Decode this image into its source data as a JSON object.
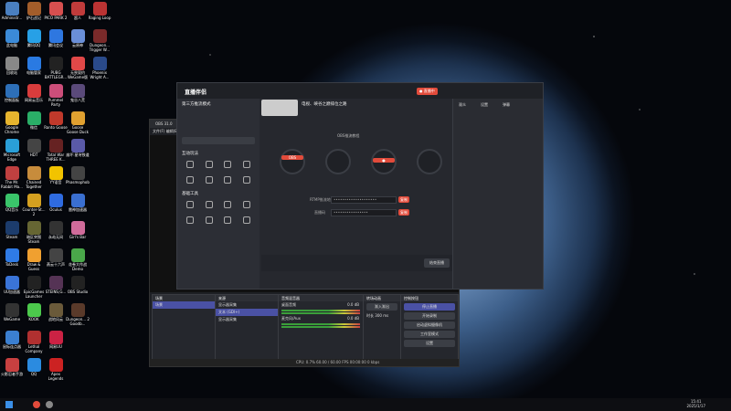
{
  "desktop": {
    "icons": [
      {
        "label": "Administr...",
        "color": "#4a7fc0"
      },
      {
        "label": "此电脑",
        "color": "#3b8ad8"
      },
      {
        "label": "回收站",
        "color": "#888"
      },
      {
        "label": "控制面板",
        "color": "#2d6fb8"
      },
      {
        "label": "Google Chrome",
        "color": "#e6b42e"
      },
      {
        "label": "Microsoft Edge",
        "color": "#2a9fd8"
      },
      {
        "label": "The Mr. Rabbit Ma...",
        "color": "#c04040"
      },
      {
        "label": "QQ音乐",
        "color": "#3ac46a"
      },
      {
        "label": "Steam",
        "color": "#1c3c6c"
      },
      {
        "label": "ToDesk",
        "color": "#2f7be6"
      },
      {
        "label": "UU加速器",
        "color": "#3a74d8"
      },
      {
        "label": "WeGame",
        "color": "#333"
      },
      {
        "label": "鼠标连点器",
        "color": "#3b7fd0"
      },
      {
        "label": "火影忍者手游",
        "color": "#c84040"
      }
    ],
    "icons2": [
      {
        "label": "炉石战记",
        "color": "#a35d2a"
      },
      {
        "label": "腾讯QQ",
        "color": "#27a0e6"
      },
      {
        "label": "电脑管家",
        "color": "#2a7ae2"
      },
      {
        "label": "网易云音乐",
        "color": "#d83c3c"
      },
      {
        "label": "微信",
        "color": "#2aae67"
      },
      {
        "label": "HDT",
        "color": "#444"
      },
      {
        "label": "Chained Together",
        "color": "#c78c3c"
      },
      {
        "label": "Counter-St... 2",
        "color": "#d4a020"
      },
      {
        "label": "暗区突围Steam",
        "color": "#663"
      },
      {
        "label": "Draw & Guess",
        "color": "#f0a030"
      },
      {
        "label": "EpicGames Launcher",
        "color": "#222"
      },
      {
        "label": "KOOK",
        "color": "#4cc94c"
      },
      {
        "label": "Lethal Company",
        "color": "#b03030"
      },
      {
        "label": "QQ",
        "color": "#2b8be0"
      }
    ],
    "icons3": [
      {
        "label": "PICO PARK 2",
        "color": "#d64f4f"
      },
      {
        "label": "腾讯会议",
        "color": "#2e77e0"
      },
      {
        "label": "PUBG BATTLEGR...",
        "color": "#222"
      },
      {
        "label": "Pummel Party",
        "color": "#cc4e7a"
      },
      {
        "label": "Ranto Goose",
        "color": "#c0392b"
      },
      {
        "label": "Total War THREE K...",
        "color": "#662222"
      },
      {
        "label": "YY语音",
        "color": "#f2c300"
      },
      {
        "label": "Oculus",
        "color": "#2f6be0"
      },
      {
        "label": "永劫无间",
        "color": "#333"
      },
      {
        "label": "燕云十六声",
        "color": "#444"
      },
      {
        "label": "STEINS;G...",
        "color": "#553355"
      },
      {
        "label": "战地风云",
        "color": "#6a5a3a"
      },
      {
        "label": "网易UU",
        "color": "#c24"
      },
      {
        "label": "Apex Legends",
        "color": "#c22"
      }
    ],
    "icons4": [
      {
        "label": "超人",
        "color": "#c03b3b"
      },
      {
        "label": "云原神",
        "color": "#6a8fd8"
      },
      {
        "label": "无畏契约 WeGame版",
        "color": "#e14848"
      },
      {
        "label": "鬼谷八荒",
        "color": "#5a4a7a"
      },
      {
        "label": "Goose Goose Duck",
        "color": "#e0a030"
      },
      {
        "label": "崩坏:星穹铁道",
        "color": "#5a5aa8"
      },
      {
        "label": "Phasmophobia",
        "color": "#444"
      },
      {
        "label": "雷神加速器",
        "color": "#3a6fd0"
      },
      {
        "label": "Girl's Bar",
        "color": "#d06b9a"
      },
      {
        "label": "花卷大作战 Demo",
        "color": "#4aa84a"
      },
      {
        "label": "OBS Studio",
        "color": "#222"
      },
      {
        "label": "Dungeon... 2 Goodb...",
        "color": "#5a3a2a"
      }
    ],
    "icons5": [
      {
        "label": "Raging Loop",
        "color": "#b33"
      },
      {
        "label": "Dungeon... Trigger W...",
        "color": "#7a2a2a"
      },
      {
        "label": "Phoenix Wright A...",
        "color": "#2a4a8a"
      }
    ]
  },
  "obs": {
    "title": "OBS 31.0",
    "menu": "文件(F)  编辑(E)",
    "scenes_title": "场景",
    "scene_item": "场景",
    "sources_title": "来源",
    "sources": [
      "显示器采集",
      "文本 (GDI+)",
      "显示器采集"
    ],
    "mixer_title": "音频混音器",
    "mixer_items": [
      "桌面音频",
      "麦克风/Aux"
    ],
    "mixer_values": [
      "0.0 dB",
      "0.0 dB"
    ],
    "transitions_title": "转场动画",
    "transition": "渐入渐出",
    "duration_label": "时长",
    "duration": "300 ms",
    "controls_title": "控制按钮",
    "controls": [
      "停止直播",
      "开始录制",
      "启动虚拟摄像机",
      "工作室模式",
      "设置"
    ],
    "status": "CPU: 0.7%   60.00 / 60.00 FPS   00:00:00   0 kbps"
  },
  "app": {
    "brand": "直播伴侣",
    "source_panel_title": "第三方推流模式",
    "stream_title": "电视、峡谷之巅排位之路",
    "interact_title": "互动玩法",
    "tools_title": "基础工具",
    "obs_help": "OBS推流教程",
    "server_label": "RTMP推流地址",
    "key_label": "直播码",
    "copy_label": "复制",
    "start_btn": "结束直播",
    "right_tabs": [
      "观众",
      "设置",
      "弹幕"
    ]
  },
  "taskbar": {
    "time": "15:41",
    "date": "2025/1/17"
  }
}
